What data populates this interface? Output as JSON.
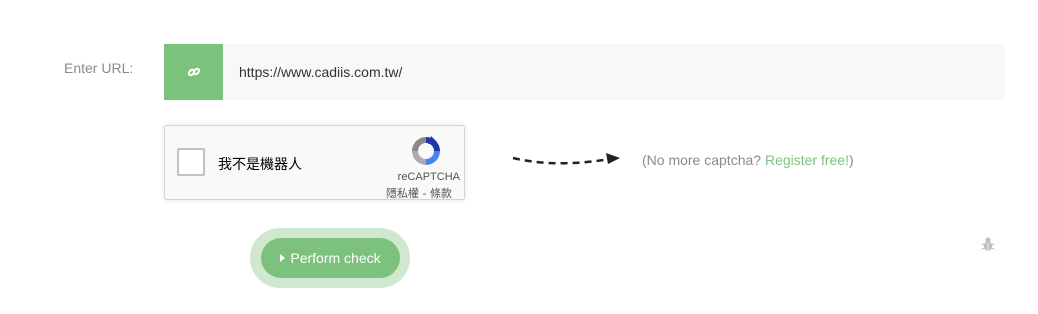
{
  "url_field": {
    "label": "Enter URL:",
    "value": "https://www.cadiis.com.tw/",
    "icon": "link-icon",
    "accent_color": "#7cc27c"
  },
  "recaptcha": {
    "checkbox_label": "我不是機器人",
    "brand": "reCAPTCHA",
    "privacy_link": "隱私權",
    "separator": " - ",
    "terms_link": "條款"
  },
  "promo": {
    "prefix": "(No more captcha? ",
    "link": "Register free!",
    "suffix": ")"
  },
  "actions": {
    "check_button": "Perform check",
    "report_icon": "bug-icon"
  }
}
